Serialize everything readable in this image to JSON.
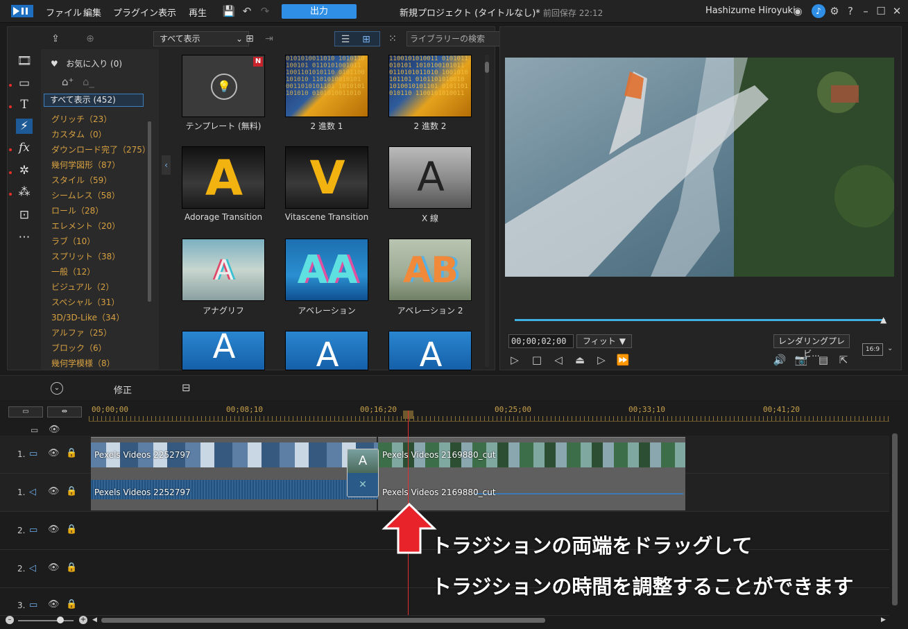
{
  "menubar": {
    "menus": [
      "ファイル",
      "編集",
      "プラグイン",
      "表示",
      "再生"
    ],
    "output_label": "出力",
    "title": "新規プロジェクト (タイトルなし)*",
    "saved": "前回保存 22:12",
    "user": "Hashizume Hiroyuki",
    "help": "?"
  },
  "library": {
    "category_select": "すべて表示",
    "search_placeholder": "ライブラリーの検索",
    "favorites": "お気に入り (0)",
    "all_label": "すべて表示 (452)",
    "categories": [
      "グリッチ（23）",
      "カスタム（0）",
      "ダウンロード完了（275）",
      "幾何学図形（87）",
      "スタイル（59）",
      "シームレス（58）",
      "ロール（28）",
      "エレメント（20）",
      "ラブ（10）",
      "スプリット（38）",
      "一般（12）",
      "ビジュアル（2）",
      "スペシャル（31）",
      "3D/3D-Like（34）",
      "アルファ（25）",
      "ブロック（6）",
      "幾何学模様（8）"
    ],
    "items": [
      {
        "label": "テンプレート (無料)",
        "badge": "N"
      },
      {
        "label": "2 進数 1"
      },
      {
        "label": "2 進数 2"
      },
      {
        "label": "Adorage Transition"
      },
      {
        "label": "Vitascene Transition"
      },
      {
        "label": "X 線"
      },
      {
        "label": "アナグリフ"
      },
      {
        "label": "アベレーション"
      },
      {
        "label": "アベレーション 2"
      }
    ]
  },
  "preview": {
    "timecode": "00;00;02;00",
    "fit": "フィット",
    "render_label": "レンダリングプレビ...",
    "aspect": "16:9"
  },
  "editbar": {
    "tab": "修正"
  },
  "timeline": {
    "ruler": [
      "00;00;00",
      "00;08;10",
      "00;16;20",
      "00;25;00",
      "00;33;10",
      "00;41;20"
    ],
    "tracks": [
      "1.",
      "1.",
      "2.",
      "2.",
      "3."
    ],
    "clips": {
      "video1": "Pexels Videos 2252797",
      "video2": "Pexels Videos 2169880_cut",
      "audio1": "Pexels Videos 2252797",
      "audio2": "Pexels Videos 2169880_cut"
    }
  },
  "annotation": {
    "line1": "トラジションの両端をドラッグして",
    "line2": "トラジションの時間を調整することができます"
  },
  "colors": {
    "accent": "#2f8fe6",
    "category": "#d7a041",
    "playhead": "#e03030",
    "annotation_arrow": "#e8232a"
  }
}
